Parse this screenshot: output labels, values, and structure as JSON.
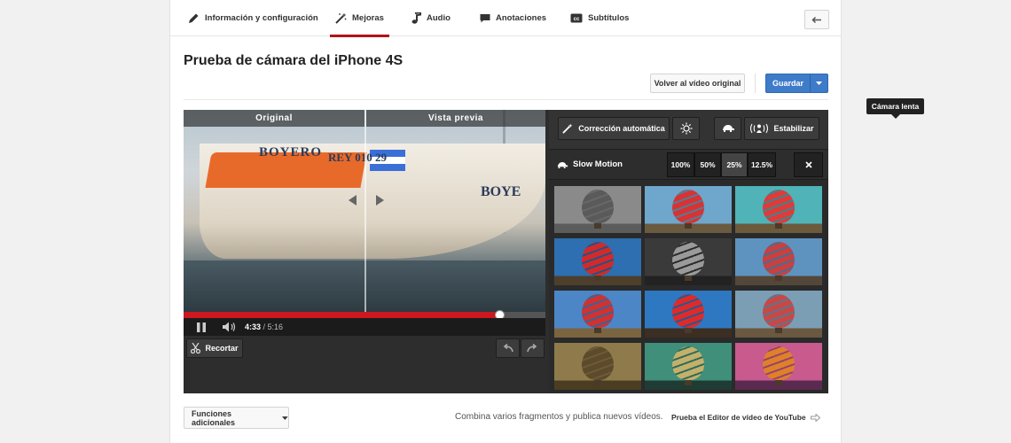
{
  "tabs": [
    {
      "label": "Información y configuración",
      "icon": "pencil-icon"
    },
    {
      "label": "Mejoras",
      "icon": "magic-wand-icon",
      "active": true
    },
    {
      "label": "Audio",
      "icon": "music-note-icon"
    },
    {
      "label": "Anotaciones",
      "icon": "speech-bubble-icon"
    },
    {
      "label": "Subtítulos",
      "icon": "cc-icon"
    }
  ],
  "title": "Prueba de cámara del iPhone 4S",
  "actions": {
    "revert_label": "Volver al vídeo original",
    "save_label": "Guardar"
  },
  "video": {
    "label_original": "Original",
    "label_preview": "Vista previa",
    "boat_text_1": "BOYERO",
    "boat_text_2": "REY 010 29",
    "boat_text_3": "BOYE",
    "time_current": "4:33",
    "time_total": "/ 5:16",
    "progress_fraction": 0.8725,
    "trim_label": "Recortar"
  },
  "panel": {
    "auto_fix_label": "Corrección automática",
    "stabilize_label": "Estabilizar",
    "tooltip": "Cámara lenta",
    "slow_motion_label": "Slow Motion",
    "speeds": [
      "100%",
      "50%",
      "25%",
      "12.5%"
    ],
    "selected_speed": "25%"
  },
  "filters": [
    {
      "sky": "#8a8a8a",
      "balloon": "#5a5a5a",
      "ground": "#5c5c5c"
    },
    {
      "sky": "#6fa6cc",
      "balloon": "#d83333",
      "ground": "#6a5a40"
    },
    {
      "sky": "#4fb3b8",
      "balloon": "#e03a3a",
      "ground": "#6b5a3c"
    },
    {
      "sky": "#2d6fb0",
      "balloon": "#d22a2a",
      "ground": "#4d3f2c"
    },
    {
      "sky": "#3a3a3a",
      "balloon": "#9a9a9a",
      "ground": "#222222"
    },
    {
      "sky": "#5e93c0",
      "balloon": "#c94040",
      "ground": "#54473a"
    },
    {
      "sky": "#4c86c6",
      "balloon": "#d03232",
      "ground": "#7a6540"
    },
    {
      "sky": "#2e78c2",
      "balloon": "#e02a2a",
      "ground": "#3c2e22"
    },
    {
      "sky": "#7b9eb5",
      "balloon": "#c84848",
      "ground": "#6a5840"
    },
    {
      "sky": "#8f7a4c",
      "balloon": "#5c4a2a",
      "ground": "#4b3d22"
    },
    {
      "sky": "#3f8f7a",
      "balloon": "#c3b06a",
      "ground": "#1f3b33"
    },
    {
      "sky": "#c85a8e",
      "balloon": "#e0802a",
      "ground": "#5a2a50"
    }
  ],
  "footer": {
    "more_label": "Funciones adicionales",
    "text": "Combina varios fragmentos y publica nuevos vídeos.",
    "link": "Prueba el Editor de vídeo de YouTube"
  },
  "colors": {
    "accent": "#b31217",
    "save": "#3e7bc8",
    "progress": "#cc181e"
  }
}
